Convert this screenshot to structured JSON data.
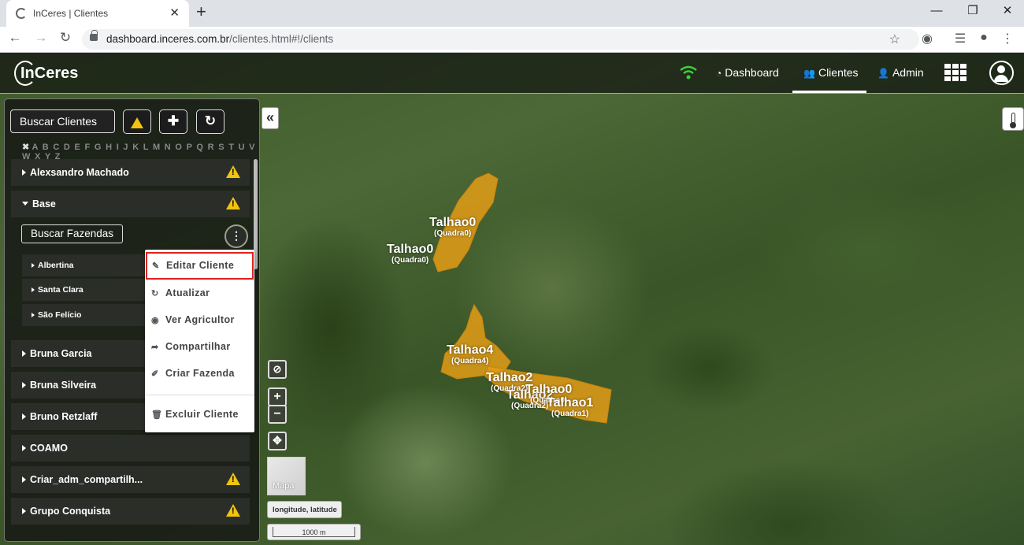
{
  "browser": {
    "tab_title": "InCeres | Clientes",
    "tab_close": "✕",
    "new_tab": "+",
    "url_host": "dashboard.inceres.com.br",
    "url_path": "/clientes.html#!/clients",
    "window_minimize": "—",
    "window_restore": "❐",
    "window_close": "✕"
  },
  "app": {
    "logo": "InCeres",
    "nav": {
      "dashboard": "Dashboard",
      "clientes": "Clientes",
      "admin": "Admin"
    },
    "active_nav": "Clientes"
  },
  "sidebar": {
    "search_clients_value": "Buscar Clientes",
    "alphabet_clear": "✖",
    "alphabet": "A B C D E F G H I J K L M N O P Q R S T U V W X Y Z",
    "clients": [
      {
        "name": "Alexsandro Machado",
        "warning": true
      },
      {
        "name": "Base",
        "warning": true,
        "expanded": true
      },
      {
        "name": "Bruna Garcia",
        "warning": false
      },
      {
        "name": "Bruna Silveira",
        "warning": false
      },
      {
        "name": "Bruno Retzlaff",
        "warning": false
      },
      {
        "name": "COAMO",
        "warning": false
      },
      {
        "name": "Criar_adm_compartilh...",
        "warning": true
      },
      {
        "name": "Grupo Conquista",
        "warning": true
      }
    ],
    "search_farms": "Buscar Fazendas",
    "farms": [
      "Albertina",
      "Santa Clara",
      "São Felício"
    ]
  },
  "context_menu": {
    "items": [
      {
        "label": "Editar Cliente",
        "icon": "pencil-icon",
        "highlighted": true
      },
      {
        "label": "Atualizar",
        "icon": "refresh-icon"
      },
      {
        "label": "Ver Agricultor",
        "icon": "user-circle-icon"
      },
      {
        "label": "Compartilhar",
        "icon": "share-icon"
      },
      {
        "label": "Criar Fazenda",
        "icon": "brush-icon"
      },
      {
        "label": "Excluir Cliente",
        "icon": "trash-icon"
      }
    ]
  },
  "map": {
    "minimap_label": "Mapa",
    "coord_label": "longitude, latitude",
    "scale_label": "1000 m",
    "plots": [
      {
        "name": "Talhao0",
        "sub": "(Quadra0)"
      },
      {
        "name": "Talhao0",
        "sub": "(Quadra0)"
      },
      {
        "name": "Talhao4",
        "sub": "(Quadra4)"
      },
      {
        "name": "Talhao2",
        "sub": "(Quadra2)"
      },
      {
        "name": "Talhao2",
        "sub": "(Quadra2)"
      },
      {
        "name": "Talhao0",
        "sub": "(Quadra0)"
      },
      {
        "name": "Talhao1",
        "sub": "(Quadra1)"
      }
    ],
    "plot_color": "#e39c16"
  }
}
